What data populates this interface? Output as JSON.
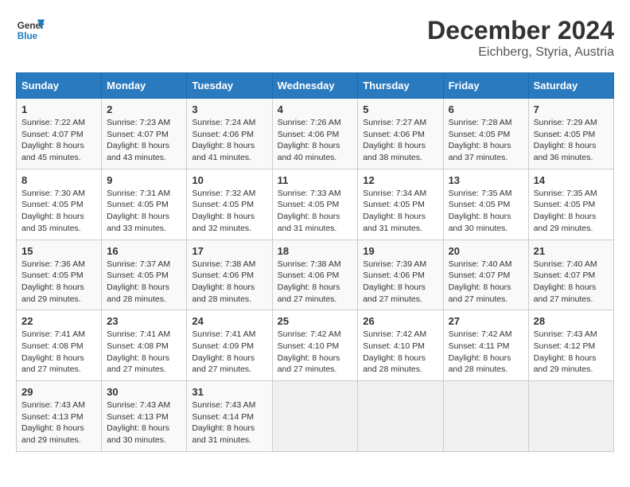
{
  "logo": {
    "line1": "General",
    "line2": "Blue"
  },
  "title": {
    "month_year": "December 2024",
    "location": "Eichberg, Styria, Austria"
  },
  "days_of_week": [
    "Sunday",
    "Monday",
    "Tuesday",
    "Wednesday",
    "Thursday",
    "Friday",
    "Saturday"
  ],
  "weeks": [
    [
      {
        "day": "1",
        "sunrise": "7:22 AM",
        "sunset": "4:07 PM",
        "daylight": "8 hours and 45 minutes."
      },
      {
        "day": "2",
        "sunrise": "7:23 AM",
        "sunset": "4:07 PM",
        "daylight": "8 hours and 43 minutes."
      },
      {
        "day": "3",
        "sunrise": "7:24 AM",
        "sunset": "4:06 PM",
        "daylight": "8 hours and 41 minutes."
      },
      {
        "day": "4",
        "sunrise": "7:26 AM",
        "sunset": "4:06 PM",
        "daylight": "8 hours and 40 minutes."
      },
      {
        "day": "5",
        "sunrise": "7:27 AM",
        "sunset": "4:06 PM",
        "daylight": "8 hours and 38 minutes."
      },
      {
        "day": "6",
        "sunrise": "7:28 AM",
        "sunset": "4:05 PM",
        "daylight": "8 hours and 37 minutes."
      },
      {
        "day": "7",
        "sunrise": "7:29 AM",
        "sunset": "4:05 PM",
        "daylight": "8 hours and 36 minutes."
      }
    ],
    [
      {
        "day": "8",
        "sunrise": "7:30 AM",
        "sunset": "4:05 PM",
        "daylight": "8 hours and 35 minutes."
      },
      {
        "day": "9",
        "sunrise": "7:31 AM",
        "sunset": "4:05 PM",
        "daylight": "8 hours and 33 minutes."
      },
      {
        "day": "10",
        "sunrise": "7:32 AM",
        "sunset": "4:05 PM",
        "daylight": "8 hours and 32 minutes."
      },
      {
        "day": "11",
        "sunrise": "7:33 AM",
        "sunset": "4:05 PM",
        "daylight": "8 hours and 31 minutes."
      },
      {
        "day": "12",
        "sunrise": "7:34 AM",
        "sunset": "4:05 PM",
        "daylight": "8 hours and 31 minutes."
      },
      {
        "day": "13",
        "sunrise": "7:35 AM",
        "sunset": "4:05 PM",
        "daylight": "8 hours and 30 minutes."
      },
      {
        "day": "14",
        "sunrise": "7:35 AM",
        "sunset": "4:05 PM",
        "daylight": "8 hours and 29 minutes."
      }
    ],
    [
      {
        "day": "15",
        "sunrise": "7:36 AM",
        "sunset": "4:05 PM",
        "daylight": "8 hours and 29 minutes."
      },
      {
        "day": "16",
        "sunrise": "7:37 AM",
        "sunset": "4:05 PM",
        "daylight": "8 hours and 28 minutes."
      },
      {
        "day": "17",
        "sunrise": "7:38 AM",
        "sunset": "4:06 PM",
        "daylight": "8 hours and 28 minutes."
      },
      {
        "day": "18",
        "sunrise": "7:38 AM",
        "sunset": "4:06 PM",
        "daylight": "8 hours and 27 minutes."
      },
      {
        "day": "19",
        "sunrise": "7:39 AM",
        "sunset": "4:06 PM",
        "daylight": "8 hours and 27 minutes."
      },
      {
        "day": "20",
        "sunrise": "7:40 AM",
        "sunset": "4:07 PM",
        "daylight": "8 hours and 27 minutes."
      },
      {
        "day": "21",
        "sunrise": "7:40 AM",
        "sunset": "4:07 PM",
        "daylight": "8 hours and 27 minutes."
      }
    ],
    [
      {
        "day": "22",
        "sunrise": "7:41 AM",
        "sunset": "4:08 PM",
        "daylight": "8 hours and 27 minutes."
      },
      {
        "day": "23",
        "sunrise": "7:41 AM",
        "sunset": "4:08 PM",
        "daylight": "8 hours and 27 minutes."
      },
      {
        "day": "24",
        "sunrise": "7:41 AM",
        "sunset": "4:09 PM",
        "daylight": "8 hours and 27 minutes."
      },
      {
        "day": "25",
        "sunrise": "7:42 AM",
        "sunset": "4:10 PM",
        "daylight": "8 hours and 27 minutes."
      },
      {
        "day": "26",
        "sunrise": "7:42 AM",
        "sunset": "4:10 PM",
        "daylight": "8 hours and 28 minutes."
      },
      {
        "day": "27",
        "sunrise": "7:42 AM",
        "sunset": "4:11 PM",
        "daylight": "8 hours and 28 minutes."
      },
      {
        "day": "28",
        "sunrise": "7:43 AM",
        "sunset": "4:12 PM",
        "daylight": "8 hours and 29 minutes."
      }
    ],
    [
      {
        "day": "29",
        "sunrise": "7:43 AM",
        "sunset": "4:13 PM",
        "daylight": "8 hours and 29 minutes."
      },
      {
        "day": "30",
        "sunrise": "7:43 AM",
        "sunset": "4:13 PM",
        "daylight": "8 hours and 30 minutes."
      },
      {
        "day": "31",
        "sunrise": "7:43 AM",
        "sunset": "4:14 PM",
        "daylight": "8 hours and 31 minutes."
      },
      null,
      null,
      null,
      null
    ]
  ]
}
